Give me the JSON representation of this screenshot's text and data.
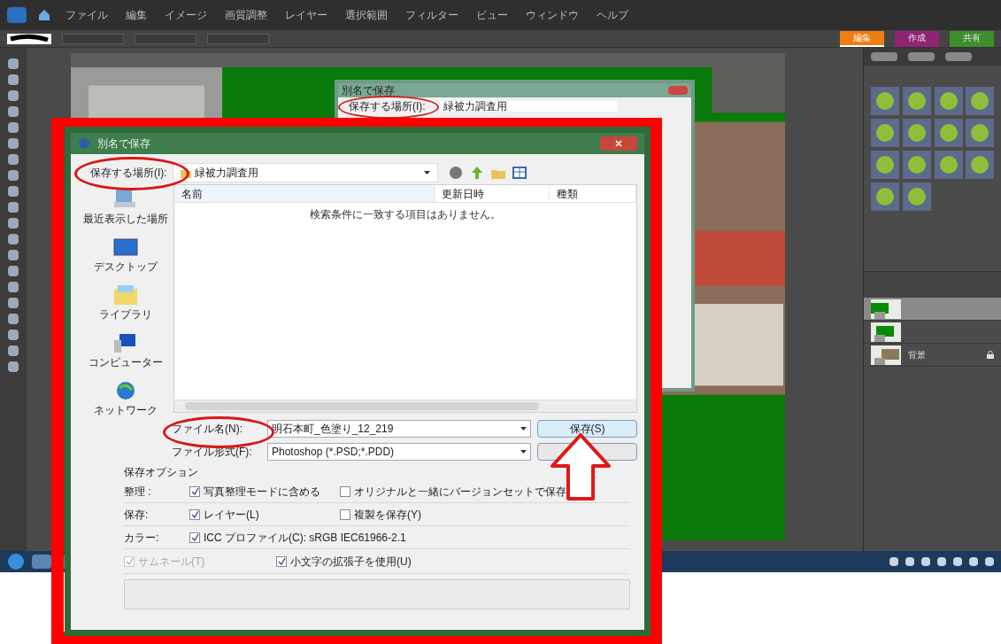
{
  "app": {
    "menu": [
      "ファイル",
      "編集",
      "イメージ",
      "画質調整",
      "レイヤー",
      "選択範囲",
      "フィルター",
      "ビュー",
      "ウィンドウ",
      "ヘルプ"
    ],
    "mode_tabs": [
      {
        "label": "編集",
        "color": "#ee7d14",
        "selected": true
      },
      {
        "label": "作成",
        "color": "#9c1f7c",
        "selected": false
      },
      {
        "label": "共有",
        "color": "#3f9a2a",
        "selected": false
      }
    ]
  },
  "layers_panel": {
    "layers": [
      {
        "kind": "picture",
        "selected": true
      },
      {
        "kind": "picture",
        "selected": false
      },
      {
        "kind": "picture",
        "name": "背景",
        "locked": true,
        "selected": false
      }
    ]
  },
  "back_dialog": {
    "title": "別名で保存",
    "location_label": "保存する場所(I):",
    "folder": "緑被力調査用"
  },
  "dialog": {
    "title": "別名で保存",
    "location_label": "保存する場所(I):",
    "folder": "緑被力調査用",
    "places": [
      {
        "kind": "recent",
        "label": "最近表示した場所"
      },
      {
        "kind": "desktop",
        "label": "デスクトップ"
      },
      {
        "kind": "library",
        "label": "ライブラリ"
      },
      {
        "kind": "computer",
        "label": "コンピューター"
      },
      {
        "kind": "network",
        "label": "ネットワーク"
      }
    ],
    "columns": [
      "名前",
      "更新日時",
      "種類"
    ],
    "empty_message": "検索条件に一致する項目はありません。",
    "file_name_label": "ファイル名(N):",
    "file_name": "明石本町_色塗り_12_219",
    "file_type_label": "ファイル形式(F):",
    "file_type": "Photoshop (*.PSD;*.PDD)",
    "save_button": "保存(S)",
    "options_title": "保存オプション",
    "option_rows": [
      {
        "label": "整理 :",
        "options": [
          {
            "label": "写真整理モードに含める",
            "checked": true,
            "disabled": false
          },
          {
            "label": "オリジナルと一緒にバージョンセットで保存",
            "checked": false,
            "disabled": false
          }
        ]
      },
      {
        "label": "保存:",
        "options": [
          {
            "label": "レイヤー(L)",
            "checked": true,
            "disabled": false
          },
          {
            "label": "複製を保存(Y)",
            "checked": false,
            "disabled": false
          }
        ]
      },
      {
        "label": "カラー:",
        "options": [
          {
            "label": "ICC プロファイル(C): sRGB IEC61966-2.1",
            "checked": true,
            "disabled": false
          }
        ]
      }
    ],
    "extra_options": [
      {
        "label": "サムネール(T)",
        "checked": true,
        "disabled": true
      },
      {
        "label": "小文字の拡張子を使用(U)",
        "checked": true,
        "disabled": false
      }
    ]
  }
}
